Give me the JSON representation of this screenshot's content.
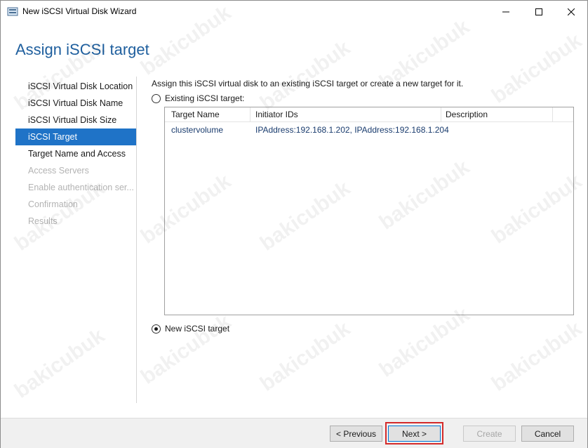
{
  "window": {
    "title": "New iSCSI Virtual Disk Wizard",
    "minimize_glyph": "—",
    "maximize_glyph": "☐",
    "close_glyph": "✕"
  },
  "page_title": "Assign iSCSI target",
  "nav": {
    "items": [
      {
        "label": "iSCSI Virtual Disk Location",
        "state": "normal"
      },
      {
        "label": "iSCSI Virtual Disk Name",
        "state": "normal"
      },
      {
        "label": "iSCSI Virtual Disk Size",
        "state": "normal"
      },
      {
        "label": "iSCSI Target",
        "state": "active"
      },
      {
        "label": "Target Name and Access",
        "state": "normal"
      },
      {
        "label": "Access Servers",
        "state": "disabled"
      },
      {
        "label": "Enable authentication ser...",
        "state": "disabled"
      },
      {
        "label": "Confirmation",
        "state": "disabled"
      },
      {
        "label": "Results",
        "state": "disabled"
      }
    ]
  },
  "content": {
    "intro": "Assign this iSCSI virtual disk to an existing iSCSI target or create a new target for it.",
    "existing_label": "Existing iSCSI target:",
    "existing_checked": false,
    "new_label": "New iSCSI target",
    "new_checked": true,
    "table": {
      "columns": [
        "Target Name",
        "Initiator IDs",
        "Description"
      ],
      "rows": [
        {
          "name": "clustervolume",
          "initiators": "IPAddress:192.168.1.202, IPAddress:192.168.1.204",
          "description": ""
        }
      ]
    }
  },
  "buttons": {
    "previous": "< Previous",
    "next": "Next >",
    "create": "Create",
    "cancel": "Cancel"
  },
  "watermark": "bakicubuk",
  "colors": {
    "accent": "#1f73c7",
    "title_blue": "#1f5f9e",
    "highlight_red": "#d42b2b"
  }
}
